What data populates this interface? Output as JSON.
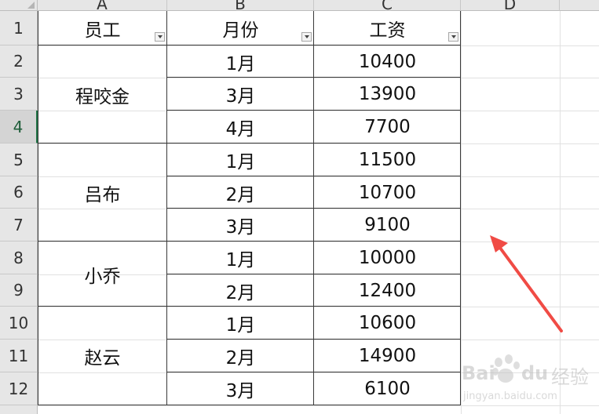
{
  "columns": [
    "A",
    "B",
    "C",
    "D"
  ],
  "rows": [
    "1",
    "2",
    "3",
    "4",
    "5",
    "6",
    "7",
    "8",
    "9",
    "10",
    "11",
    "12"
  ],
  "active_row": "4",
  "table": {
    "headers": [
      "员工",
      "月份",
      "工资"
    ],
    "employees": [
      "程咬金",
      "吕布",
      "小乔",
      "赵云"
    ],
    "months": [
      "1月",
      "3月",
      "4月",
      "1月",
      "2月",
      "3月",
      "1月",
      "2月",
      "1月",
      "2月",
      "3月"
    ],
    "salaries": [
      "10400",
      "13900",
      "7700",
      "11500",
      "10700",
      "9100",
      "10000",
      "12400",
      "10600",
      "14900",
      "6100"
    ]
  },
  "watermark": {
    "brand": "Bai",
    "brand2": "du",
    "product": "经验",
    "url": "jingyan.baidu.com"
  },
  "colors": {
    "arrow": "#f04b45",
    "accent": "#217346"
  }
}
